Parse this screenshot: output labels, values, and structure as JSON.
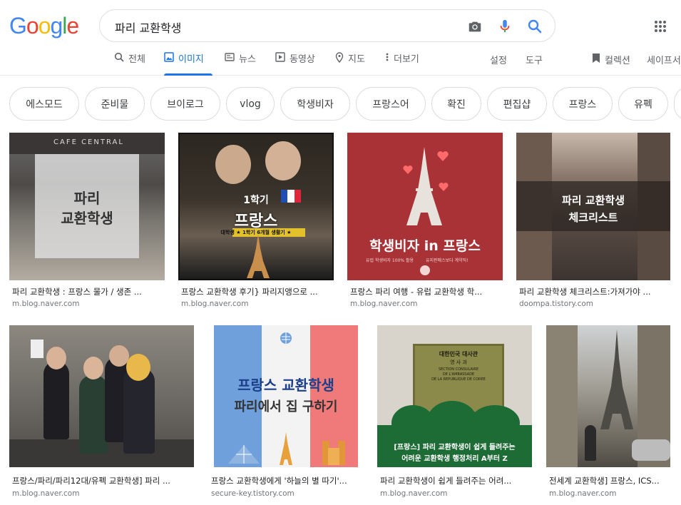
{
  "logo": {
    "g1": "G",
    "o1": "o",
    "o2": "o",
    "g2": "g",
    "l": "l",
    "e": "e"
  },
  "search": {
    "query": "파리 교환학생"
  },
  "tabs": [
    {
      "label": "전체"
    },
    {
      "label": "이미지"
    },
    {
      "label": "뉴스"
    },
    {
      "label": "동영상"
    },
    {
      "label": "지도"
    },
    {
      "label": "더보기"
    }
  ],
  "tools": {
    "settings": "설정",
    "tools": "도구",
    "collections": "컬렉션",
    "safesearch": "세이프서"
  },
  "chips": [
    "에스모드",
    "준비물",
    "브이로그",
    "vlog",
    "학생비자",
    "프랑스어",
    "확진",
    "편집샵",
    "프랑스",
    "유펙"
  ],
  "results": [
    {
      "title": "파리 교환학생 : 프랑스 물가 / 생존 ...",
      "source": "m.blog.naver.com",
      "overlay": [
        "파리",
        "교환학생"
      ],
      "sign": "CAFE CENTRAL"
    },
    {
      "title": "프랑스 교환학생 후기} 파리지앵으로 ...",
      "source": "m.blog.naver.com",
      "overlay": [
        "1학기",
        "프랑스",
        "대학생 ★ 1학기 6개월 생활기 ★"
      ]
    },
    {
      "title": "프랑스 파리 여행 - 유럽 교환학생 학...",
      "source": "m.blog.naver.com",
      "overlay": [
        "학생비자 in 프랑스",
        "유럽 학생비자 100% 활용",
        "유지판매스보다 계약직!"
      ]
    },
    {
      "title": "파리 교환학생 체크리스트:가져가야 ...",
      "source": "doompa.tistory.com",
      "overlay": [
        "파리 교환학생",
        "체크리스트"
      ]
    },
    {
      "title": "프랑스/파리/파리12대/유펙 교환학생] 파리 ...",
      "source": "m.blog.naver.com"
    },
    {
      "title": "프랑스 교환학생에게 '하늘의 별 따기'...",
      "source": "secure-key.tistory.com",
      "overlay": [
        "프랑스 교환학생",
        "파리에서 집 구하기"
      ]
    },
    {
      "title": "파리 교환학생이 쉽게 들려주는 어려...",
      "source": "m.blog.naver.com",
      "overlay": [
        "[프랑스] 파리 교환학생이 쉽게 들려주는",
        "어려운 교환학생 행정처리 A부터 Z"
      ],
      "plaque": [
        "대한민국 대사관",
        "영 사 과",
        "SECTION CONSULAIRE",
        "DE L'AMBASSADE",
        "DE LA REPUBLIQUE DE COREE"
      ]
    },
    {
      "title": "전세계 교환학생] 프랑스, ICS...",
      "source": "m.blog.naver.com"
    }
  ],
  "colors": {
    "accent": "#1a73e8",
    "red_card": "#a83236",
    "blue_flag": "#6fa0dc",
    "red_flag": "#f07a7a",
    "green_banner": "#1d6b35"
  }
}
